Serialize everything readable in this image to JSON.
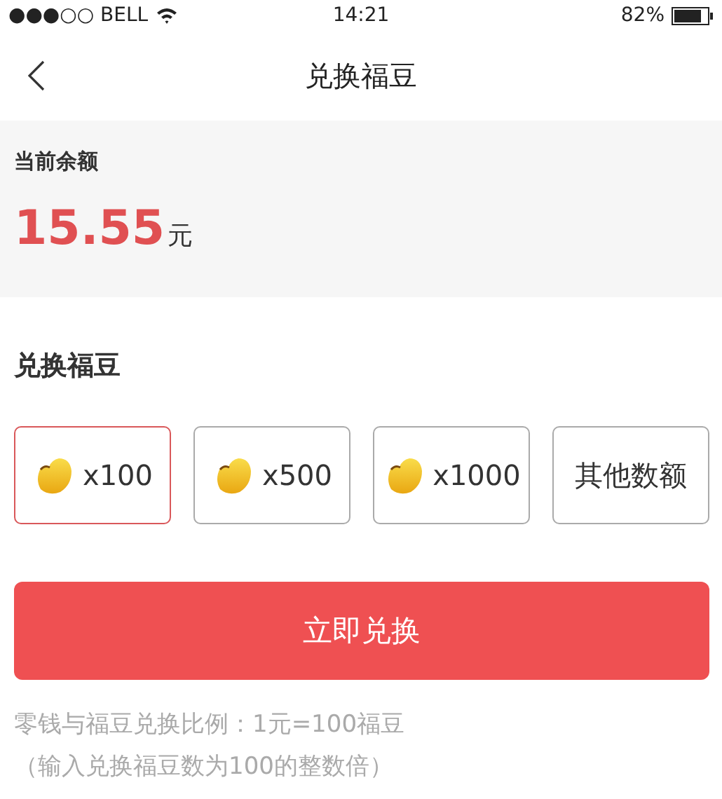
{
  "status_bar": {
    "carrier": "●●●○○ BELL",
    "time": "14:21",
    "battery": "82%"
  },
  "nav": {
    "title": "兑换福豆"
  },
  "balance": {
    "label": "当前余额",
    "amount": "15.55",
    "unit": "元"
  },
  "exchange": {
    "title": "兑换福豆",
    "options": [
      {
        "kind": "bean",
        "label": "x100",
        "selected": true
      },
      {
        "kind": "bean",
        "label": "x500",
        "selected": false
      },
      {
        "kind": "bean",
        "label": "x1000",
        "selected": false
      },
      {
        "kind": "text",
        "label": "其他数额",
        "selected": false
      }
    ],
    "button": "立即兑换"
  },
  "notes": [
    "零钱与福豆兑换比例：1元=100福豆",
    "（输入兑换福豆数为100的整数倍）"
  ]
}
